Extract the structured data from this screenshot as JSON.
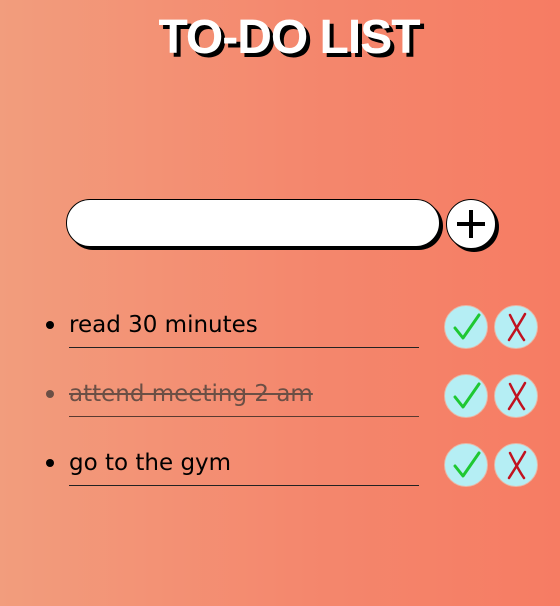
{
  "header": {
    "title": "TO-DO LIST"
  },
  "input": {
    "value": "",
    "placeholder": ""
  },
  "add_button": {
    "icon": "plus-icon"
  },
  "todos": [
    {
      "text": "read 30 minutes",
      "completed": false
    },
    {
      "text": "attend meeting 2 am",
      "completed": true
    },
    {
      "text": "go to the gym",
      "completed": false
    }
  ],
  "actions": {
    "complete_icon": "checkmark-icon",
    "delete_icon": "x-icon"
  },
  "colors": {
    "background_start": "#f29d7d",
    "background_end": "#f67c63",
    "action_button_bg": "#b5eef4",
    "check_color": "#1ec832",
    "delete_color": "#c1121f",
    "completed_text": "#6b4f45"
  }
}
